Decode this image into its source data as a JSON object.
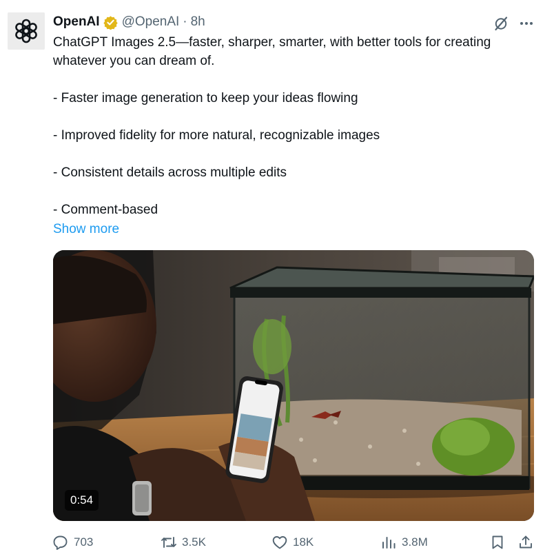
{
  "author": {
    "display_name": "OpenAI",
    "handle": "@OpenAI",
    "separator": "·",
    "time": "8h",
    "avatar_icon": "openai-logo-icon",
    "verified_color": "#e2b719"
  },
  "tweet": {
    "lines": [
      "ChatGPT Images 2.5—faster, sharper, smarter, with better tools for creating whatever you can dream of.",
      "- Faster image generation to keep your ideas flowing",
      "- Improved fidelity for more natural, recognizable images",
      "- Consistent details across multiple edits",
      "- Comment-based"
    ],
    "show_more": "Show more"
  },
  "media": {
    "duration": "0:54"
  },
  "actions": {
    "replies": "703",
    "reposts": "3.5K",
    "likes": "18K",
    "views": "3.8M"
  },
  "colors": {
    "text": "#0f1419",
    "secondary": "#536471",
    "link": "#1d9bf0"
  }
}
